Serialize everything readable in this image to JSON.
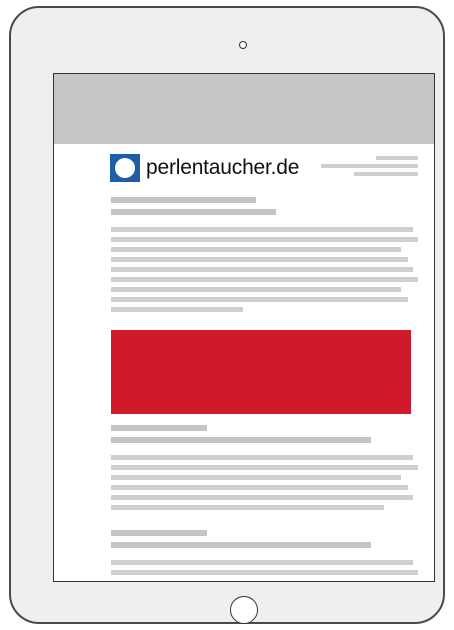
{
  "site": {
    "name": "perlentaucher.de"
  },
  "colors": {
    "brand_blue": "#1f5da6",
    "banner_red": "#cf1a2c",
    "header_gray": "#c6c6c6",
    "placeholder_gray": "#cfcfcf",
    "device_frame": "#efefef"
  },
  "icons": {
    "logo": "perlentaucher-logo-icon",
    "camera": "camera-icon",
    "home": "home-button-icon"
  }
}
